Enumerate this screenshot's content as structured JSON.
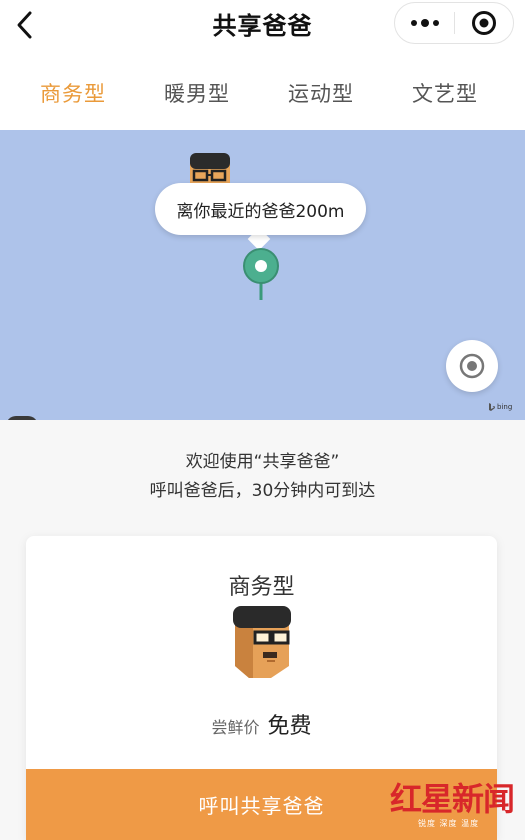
{
  "header": {
    "title": "共享爸爸",
    "back_icon": "chevron-left-icon",
    "more_icon": "more-dots-icon",
    "target_icon": "target-circle-icon"
  },
  "tabs": [
    {
      "label": "商务型",
      "active": true
    },
    {
      "label": "暖男型",
      "active": false
    },
    {
      "label": "运动型",
      "active": false
    },
    {
      "label": "文艺型",
      "active": false
    }
  ],
  "map": {
    "bubble_text": "离你最近的爸爸200m",
    "locate_icon": "locate-icon",
    "attribution": "bing",
    "background_color": "#aec3ea",
    "pin_color": "#4caf8f"
  },
  "welcome": {
    "line1": "欢迎使用“共享爸爸”",
    "line2": "呼叫爸爸后，30分钟内可到达"
  },
  "card": {
    "title": "商务型",
    "price_label": "尝鲜价",
    "price_value": "免费",
    "button_label": "呼叫共享爸爸"
  },
  "watermark": {
    "text": "红星新闻",
    "sub": "锐度 深度 温度"
  },
  "colors": {
    "accent": "#ea9a3a",
    "button": "#ef9a46",
    "watermark": "#d8272a"
  }
}
